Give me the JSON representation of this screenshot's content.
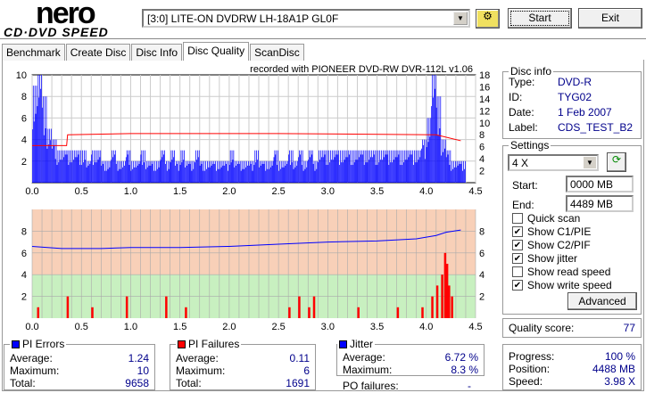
{
  "app": {
    "logo_top": "nero",
    "logo_bottom": "CD·DVD SPEED"
  },
  "drive": {
    "selected": "[3:0]  LITE-ON DVDRW LH-18A1P GL0F"
  },
  "buttons": {
    "start": "Start",
    "exit": "Exit"
  },
  "tabs": [
    "Benchmark",
    "Create Disc",
    "Disc Info",
    "Disc Quality",
    "ScanDisc"
  ],
  "active_tab": "Disc Quality",
  "recorded_with": "recorded with PIONEER DVD-RW  DVR-112L v1.06",
  "disc_info": {
    "title": "Disc info",
    "type_label": "Type:",
    "type": "DVD-R",
    "id_label": "ID:",
    "id": "TYG02",
    "date_label": "Date:",
    "date": "1 Feb 2007",
    "label_label": "Label:",
    "label": "CDS_TEST_B2"
  },
  "settings": {
    "title": "Settings",
    "speed": "4 X",
    "start_label": "Start:",
    "start": "0000 MB",
    "end_label": "End:",
    "end": "4489 MB",
    "checks": [
      {
        "label": "Quick scan",
        "checked": false
      },
      {
        "label": "Show C1/PIE",
        "checked": true
      },
      {
        "label": "Show C2/PIF",
        "checked": true
      },
      {
        "label": "Show jitter",
        "checked": true
      },
      {
        "label": "Show read speed",
        "checked": false
      },
      {
        "label": "Show write speed",
        "checked": true
      }
    ],
    "advanced": "Advanced"
  },
  "quality": {
    "label": "Quality score:",
    "value": "77"
  },
  "progress": {
    "progress_label": "Progress:",
    "progress": "100 %",
    "position_label": "Position:",
    "position": "4488 MB",
    "speed_label": "Speed:",
    "speed": "3.98 X"
  },
  "pi_errors": {
    "title": "PI Errors",
    "avg_label": "Average:",
    "avg": "1.24",
    "max_label": "Maximum:",
    "max": "10",
    "total_label": "Total:",
    "total": "9658"
  },
  "pi_failures": {
    "title": "PI Failures",
    "avg_label": "Average:",
    "avg": "0.11",
    "max_label": "Maximum:",
    "max": "6",
    "total_label": "Total:",
    "total": "1691"
  },
  "jitter": {
    "title": "Jitter",
    "avg_label": "Average:",
    "avg": "6.72 %",
    "max_label": "Maximum:",
    "max": "8.3 %",
    "po_label": "PO failures:",
    "po": "-"
  },
  "colors": {
    "pie": "#0000ff",
    "pif": "#ff0000",
    "jitter": "#0000ff",
    "speed": "#ff0000",
    "bad": "#f8d0b8",
    "good": "#c8f0c0"
  },
  "chart_data": [
    {
      "type": "bar",
      "name": "PI Errors",
      "x_range": [
        0,
        4.5
      ],
      "ylim": [
        0,
        10
      ],
      "y2lim": [
        0,
        18
      ],
      "xticks": [
        "0.0",
        "0.5",
        "1.0",
        "1.5",
        "2.0",
        "2.5",
        "3.0",
        "3.5",
        "4.0",
        "4.5"
      ],
      "yticks": [
        "2",
        "4",
        "6",
        "8",
        "10"
      ],
      "y2ticks": [
        "2",
        "4",
        "6",
        "8",
        "10",
        "12",
        "14",
        "16",
        "18"
      ],
      "pie_x_step": 0.05,
      "pie_values": [
        9,
        10,
        8,
        5,
        4,
        3,
        3,
        3,
        3,
        3,
        3,
        2,
        3,
        3,
        2,
        2,
        3,
        2,
        2,
        3,
        2,
        2,
        3,
        2,
        2,
        2,
        3,
        2,
        3,
        2,
        3,
        2,
        2,
        3,
        2,
        2,
        2,
        2,
        2,
        2,
        3,
        2,
        2,
        2,
        2,
        3,
        2,
        2,
        2,
        3,
        2,
        2,
        3,
        2,
        3,
        2,
        3,
        2,
        3,
        3,
        3,
        3,
        3,
        3,
        3,
        3,
        3,
        3,
        3,
        3,
        3,
        3,
        3,
        3,
        3,
        3,
        3,
        3,
        3,
        4,
        6,
        10,
        8,
        4,
        3,
        2,
        2,
        2
      ],
      "write_speed": {
        "x": [
          0,
          0.35,
          0.36,
          1.0,
          2.5,
          4.1,
          4.35
        ],
        "y": [
          6.2,
          6.2,
          8,
          8.2,
          8.2,
          8,
          7
        ]
      }
    },
    {
      "type": "bar+line",
      "name": "PI Failures / Jitter",
      "x_range": [
        0,
        4.5
      ],
      "ylim": [
        0,
        10
      ],
      "threshold": 4,
      "xticks": [
        "0.0",
        "0.5",
        "1.0",
        "1.5",
        "2.0",
        "2.5",
        "3.0",
        "3.5",
        "4.0",
        "4.5"
      ],
      "yticks": [
        "2",
        "4",
        "6",
        "8"
      ],
      "pif": [
        [
          0.05,
          1
        ],
        [
          0.35,
          2
        ],
        [
          0.6,
          1
        ],
        [
          0.95,
          2
        ],
        [
          1.35,
          2
        ],
        [
          1.55,
          1
        ],
        [
          2.6,
          1
        ],
        [
          2.7,
          2
        ],
        [
          2.8,
          1
        ],
        [
          2.85,
          2
        ],
        [
          3.3,
          1
        ],
        [
          3.7,
          1
        ],
        [
          3.95,
          1
        ],
        [
          4.05,
          2
        ],
        [
          4.1,
          3
        ],
        [
          4.15,
          4
        ],
        [
          4.18,
          6
        ],
        [
          4.2,
          5
        ],
        [
          4.22,
          3
        ],
        [
          4.25,
          2
        ]
      ],
      "jitter": {
        "x": [
          0,
          0.3,
          0.7,
          1.0,
          1.5,
          2.0,
          2.5,
          3.0,
          3.5,
          3.9,
          4.1,
          4.2,
          4.35
        ],
        "y": [
          6.6,
          6.4,
          6.4,
          6.5,
          6.5,
          6.6,
          6.8,
          7.0,
          7.1,
          7.3,
          7.6,
          7.9,
          8.1
        ]
      }
    }
  ]
}
